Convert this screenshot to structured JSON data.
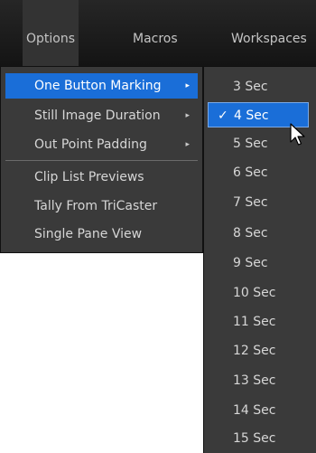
{
  "menubar": {
    "items": [
      {
        "label": "Options",
        "active": true
      },
      {
        "label": "Macros",
        "active": false
      },
      {
        "label": "Workspaces",
        "active": false
      }
    ]
  },
  "options_menu": {
    "items": [
      {
        "label": "One Button Marking",
        "submenu": true,
        "highlighted": true
      },
      {
        "label": "Still Image Duration",
        "submenu": true
      },
      {
        "label": "Out Point Padding",
        "submenu": true
      },
      {
        "label": "Clip List Previews",
        "submenu": false
      },
      {
        "label": "Tally From TriCaster",
        "submenu": false
      },
      {
        "label": "Single Pane View",
        "submenu": false
      }
    ]
  },
  "submenu": {
    "items": [
      {
        "label": "3 Sec"
      },
      {
        "label": "4 Sec",
        "checked": true
      },
      {
        "label": "5 Sec"
      },
      {
        "label": "6 Sec"
      },
      {
        "label": "7 Sec"
      },
      {
        "label": "8 Sec"
      },
      {
        "label": "9 Sec"
      },
      {
        "label": "10 Sec"
      },
      {
        "label": "11 Sec"
      },
      {
        "label": "12 Sec"
      },
      {
        "label": "13 Sec"
      },
      {
        "label": "14 Sec"
      },
      {
        "label": "15 Sec"
      }
    ]
  },
  "icons": {
    "submenu_arrow": "▸",
    "check": "✓",
    "cursor": "mouse-pointer-icon"
  },
  "colors": {
    "menubar_bg": "#1a1a1a",
    "menu_bg": "#3a3a3a",
    "highlight": "#1a6ed8",
    "text": "#d6d6d6"
  }
}
